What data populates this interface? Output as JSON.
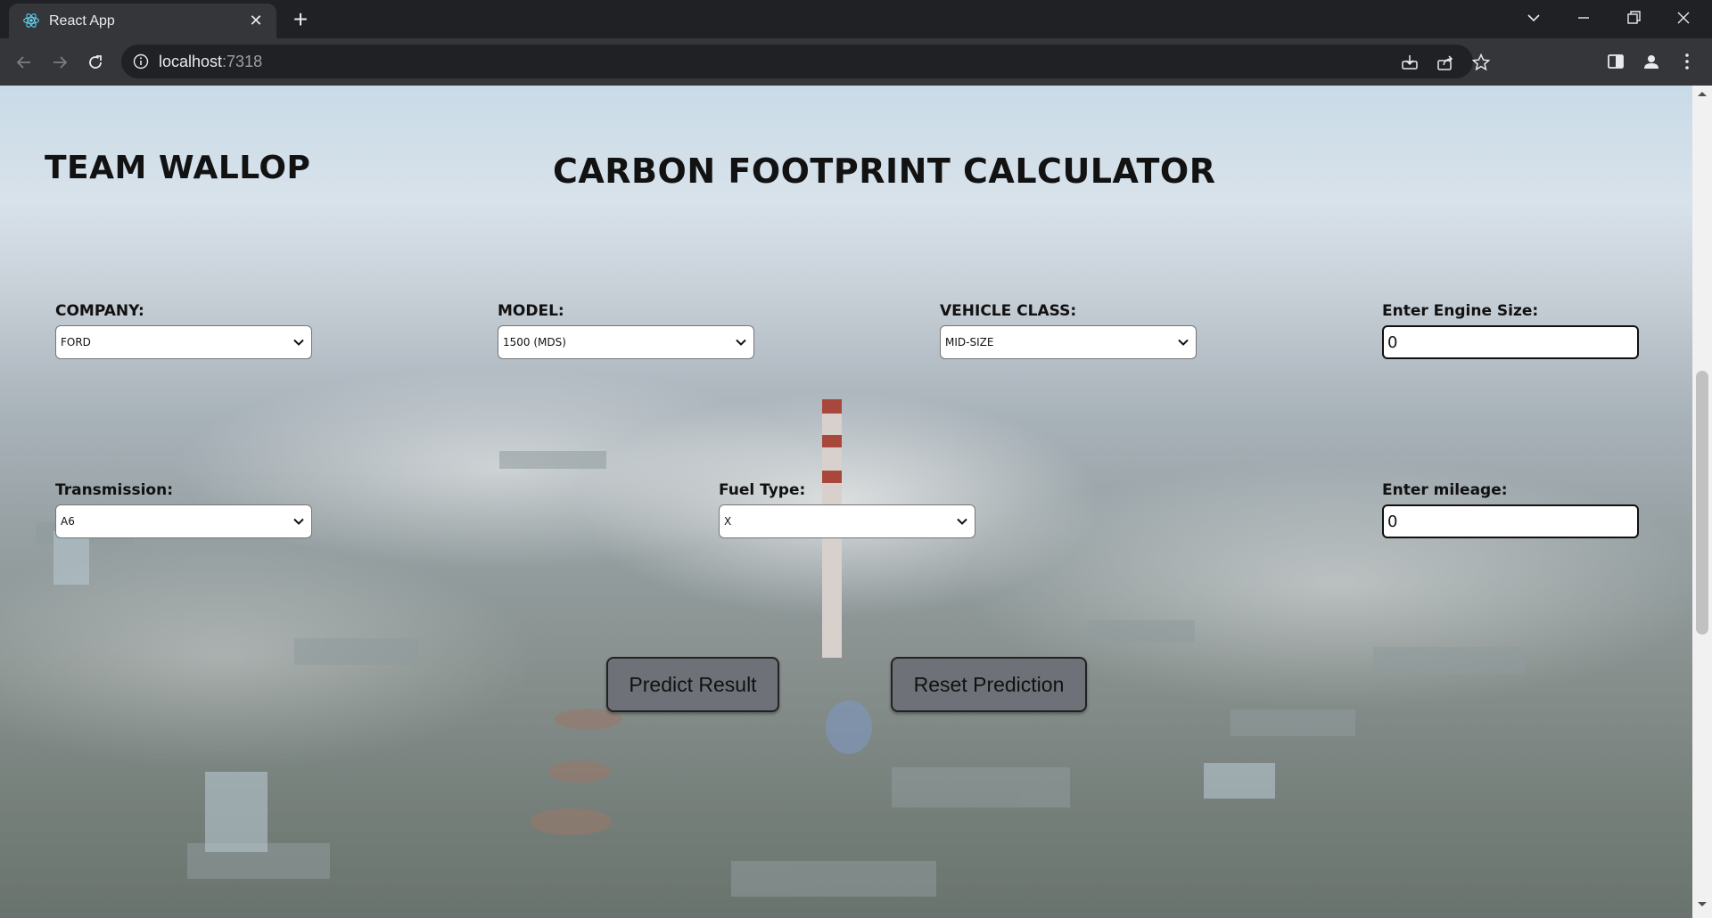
{
  "browser": {
    "tab_title": "React App",
    "url_host": "localhost",
    "url_port": ":7318"
  },
  "page": {
    "brand": "TEAM WALLOP",
    "title": "CARBON FOOTPRINT CALCULATOR"
  },
  "form": {
    "company": {
      "label": "COMPANY:",
      "value": "FORD"
    },
    "model": {
      "label": "MODEL:",
      "value": "1500 (MDS)"
    },
    "vehicle_class": {
      "label": "VEHICLE CLASS:",
      "value": "MID-SIZE"
    },
    "engine_size": {
      "label": "Enter Engine Size:",
      "value": "0"
    },
    "transmission": {
      "label": "Transmission:",
      "value": "A6"
    },
    "fuel_type": {
      "label": "Fuel Type:",
      "value": "X"
    },
    "mileage": {
      "label": "Enter mileage:",
      "value": "0"
    }
  },
  "buttons": {
    "predict": "Predict Result",
    "reset": "Reset Prediction"
  },
  "colors": {
    "button_bg": "#6e7278",
    "chrome_bg": "#202124",
    "toolbar_bg": "#35363a"
  }
}
